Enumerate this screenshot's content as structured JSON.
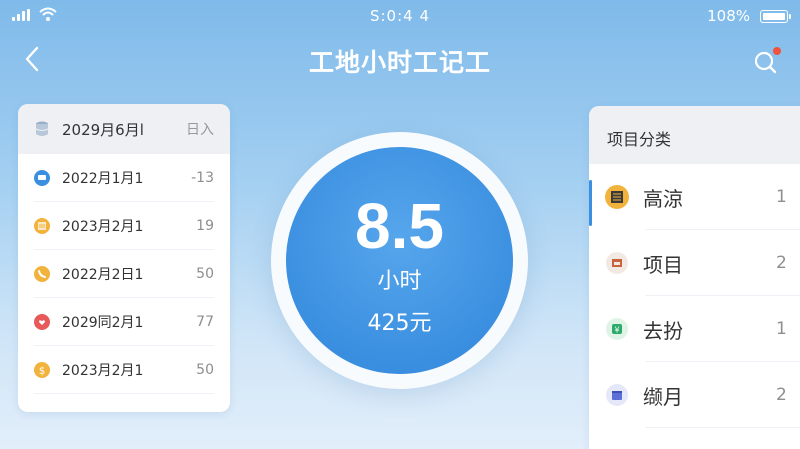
{
  "status_bar": {
    "time": "S:0:4 4",
    "battery": "108%"
  },
  "nav": {
    "title": "工地小时工记工"
  },
  "records": {
    "header": {
      "date": "2029月6月l",
      "extra": "日入"
    },
    "items": [
      {
        "date": "2022月1月1",
        "value": "-13",
        "icon": "message-icon",
        "color": "#3b8fe0"
      },
      {
        "date": "2023月2月1",
        "value": "19",
        "icon": "notebook-icon",
        "color": "#f2b33d"
      },
      {
        "date": "2022月2日1",
        "value": "50",
        "icon": "phone-icon",
        "color": "#f2b33d"
      },
      {
        "date": "2029同2月1",
        "value": "77",
        "icon": "heart-icon",
        "color": "#e85a5a"
      },
      {
        "date": "2023月2月1",
        "value": "50",
        "icon": "coin-icon",
        "color": "#f2b33d"
      }
    ]
  },
  "summary": {
    "hours": "8.5",
    "unit": "小时",
    "amount": "425元"
  },
  "categories": {
    "title": "项目分类",
    "items": [
      {
        "name": "高涼",
        "count": "1",
        "icon": "building-icon",
        "color": "#f2b33d",
        "active": true
      },
      {
        "name": "项目",
        "count": "2",
        "icon": "shop-icon",
        "color": "#ffffff"
      },
      {
        "name": "去扮",
        "count": "1",
        "icon": "money-icon",
        "color": "#2eaa6a"
      },
      {
        "name": "缬月",
        "count": "2",
        "icon": "calendar-icon",
        "color": "#5b6fd6"
      }
    ]
  }
}
